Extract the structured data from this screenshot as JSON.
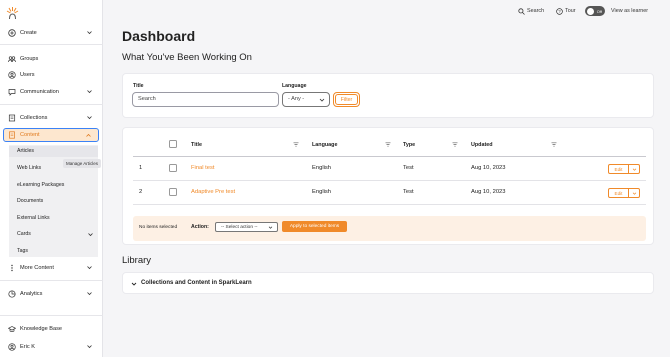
{
  "sidebar": {
    "items": [
      {
        "label": "Create"
      },
      {
        "label": "Groups"
      },
      {
        "label": "Users"
      },
      {
        "label": "Communication"
      },
      {
        "label": "Collections"
      },
      {
        "label": "Content"
      },
      {
        "label": "More Content"
      },
      {
        "label": "Analytics"
      },
      {
        "label": "Knowledge Base"
      },
      {
        "label": "Eric K"
      }
    ],
    "content_subitems": [
      {
        "label": "Articles"
      },
      {
        "label": "Web Links"
      },
      {
        "label": "eLearning Packages"
      },
      {
        "label": "Documents"
      },
      {
        "label": "External Links"
      },
      {
        "label": "Cards"
      },
      {
        "label": "Tags"
      }
    ],
    "tooltip": "Manage Articles"
  },
  "topbar": {
    "search": "Search",
    "tour": "Tour",
    "toggle": "Off",
    "view_as_learner": "View as learner"
  },
  "page": {
    "title": "Dashboard",
    "subtitle": "What You've Been Working On",
    "library": "Library"
  },
  "filter": {
    "title_label": "Title",
    "title_placeholder": "Search",
    "language_label": "Language",
    "language_value": "- Any -",
    "filter_button": "Filter"
  },
  "table": {
    "headers": {
      "title": "Title",
      "language": "Language",
      "type": "Type",
      "updated": "Updated"
    },
    "rows": [
      {
        "num": "1",
        "title": "Final test",
        "language": "English",
        "type": "Test",
        "updated": "Aug 10, 2023",
        "action": "Edit"
      },
      {
        "num": "2",
        "title": "Adaptive Pre test",
        "language": "English",
        "type": "Test",
        "updated": "Aug 10, 2023",
        "action": "Edit"
      }
    ],
    "footer": {
      "selected": "No items selected",
      "action_label": "Action:",
      "action_select": "-- Select action --",
      "apply": "Apply to selected items"
    }
  },
  "library": {
    "accordion": "Collections and Content in SparkLearn"
  },
  "colors": {
    "accent": "#f08a2a",
    "active_bg": "#fde7cf",
    "focus": "#3b82f6"
  }
}
